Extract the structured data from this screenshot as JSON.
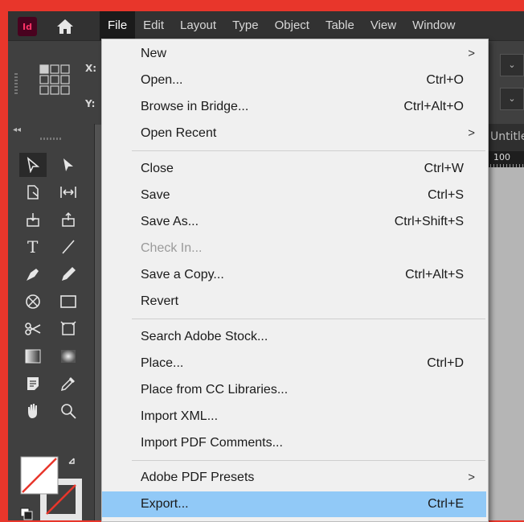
{
  "app": {
    "logo_text": "Id"
  },
  "menubar": {
    "items": [
      "File",
      "Edit",
      "Layout",
      "Type",
      "Object",
      "Table",
      "View",
      "Window"
    ],
    "active": "File"
  },
  "control": {
    "x_label": "X:",
    "y_label": "Y:"
  },
  "document": {
    "tab_title": "Untitled-",
    "ruler_value": "100"
  },
  "file_menu": {
    "new": {
      "label": "New",
      "submenu": true
    },
    "open": {
      "label": "Open...",
      "shortcut": "Ctrl+O"
    },
    "browse": {
      "label": "Browse in Bridge...",
      "shortcut": "Ctrl+Alt+O"
    },
    "open_recent": {
      "label": "Open Recent",
      "submenu": true
    },
    "close": {
      "label": "Close",
      "shortcut": "Ctrl+W"
    },
    "save": {
      "label": "Save",
      "shortcut": "Ctrl+S"
    },
    "save_as": {
      "label": "Save As...",
      "shortcut": "Ctrl+Shift+S"
    },
    "check_in": {
      "label": "Check In...",
      "disabled": true
    },
    "save_copy": {
      "label": "Save a Copy...",
      "shortcut": "Ctrl+Alt+S"
    },
    "revert": {
      "label": "Revert"
    },
    "search_stock": {
      "label": "Search Adobe Stock..."
    },
    "place": {
      "label": "Place...",
      "shortcut": "Ctrl+D"
    },
    "place_cc": {
      "label": "Place from CC Libraries..."
    },
    "import_xml": {
      "label": "Import XML..."
    },
    "import_pdf_comments": {
      "label": "Import PDF Comments..."
    },
    "pdf_presets": {
      "label": "Adobe PDF Presets",
      "submenu": true
    },
    "export": {
      "label": "Export...",
      "shortcut": "Ctrl+E",
      "highlighted": true
    },
    "submenu_arrow": ">"
  },
  "colors": {
    "frame": "#e8362b",
    "highlight": "#91c9f7",
    "menu_bg": "#f0f0f0",
    "menubar_bg": "#323232"
  }
}
